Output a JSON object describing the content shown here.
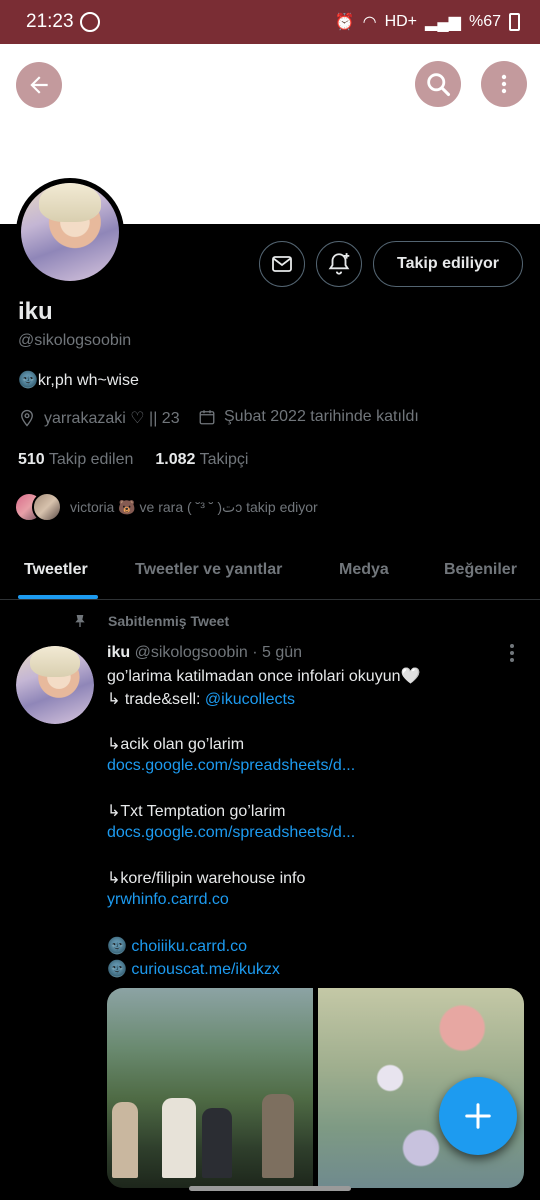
{
  "status": {
    "time": "21:23",
    "right_text": "HD+",
    "battery": "%67"
  },
  "profile": {
    "name": "iku",
    "handle": "@sikologsoobin",
    "bio": "🌚kr,ph wh~wise",
    "location": "yarrakazaki ♡ || 23",
    "joined": "Şubat 2022 tarihinde katıldı",
    "following_count": "510",
    "following_label": "Takip edilen",
    "followers_count": "1.082",
    "followers_label": "Takipçi",
    "followed_by": "victoria 🐻 ve rara ت( ˘ ³˘ )ɔ takip ediyor",
    "follow_button": "Takip ediliyor"
  },
  "tabs": [
    "Tweetler",
    "Tweetler ve yanıtlar",
    "Medya",
    "Beğeniler"
  ],
  "active_tab": 0,
  "tweet": {
    "pinned_label": "Sabitlenmiş Tweet",
    "author_name": "iku",
    "author_handle": "@sikologsoobin",
    "time": "· 5 gün",
    "lines": [
      {
        "text": "go’larima katilmadan once infolari okuyun🤍",
        "link": false
      },
      {
        "text": "↳ trade&sell: ",
        "link_text": "@ikucollects",
        "link": "mixed"
      },
      {
        "text": "↳acik olan go’larim",
        "link": false
      },
      {
        "text": "docs.google.com/spreadsheets/d...",
        "link": true
      },
      {
        "text": "↳Txt Temptation go’larim",
        "link": false
      },
      {
        "text": "docs.google.com/spreadsheets/d...",
        "link": true
      },
      {
        "text": "↳kore/filipin warehouse info",
        "link": false
      },
      {
        "text": "yrwhinfo.carrd.co",
        "link": true
      },
      {
        "text": "🌚 ",
        "link_text": "choiiiku.carrd.co",
        "link": "mixed"
      },
      {
        "text": "🌚 ",
        "link_text": "curiouscat.me/ikukzx",
        "link": "mixed"
      }
    ]
  },
  "icons": {
    "back": "arrow-left-icon",
    "search": "search-icon",
    "more": "more-vertical-icon",
    "message": "mail-icon",
    "notify": "bell-plus-icon",
    "compose": "plus-icon"
  },
  "colors": {
    "accent": "#1d9bf0",
    "status_bar": "#7a2d34",
    "muted": "#71767b"
  }
}
